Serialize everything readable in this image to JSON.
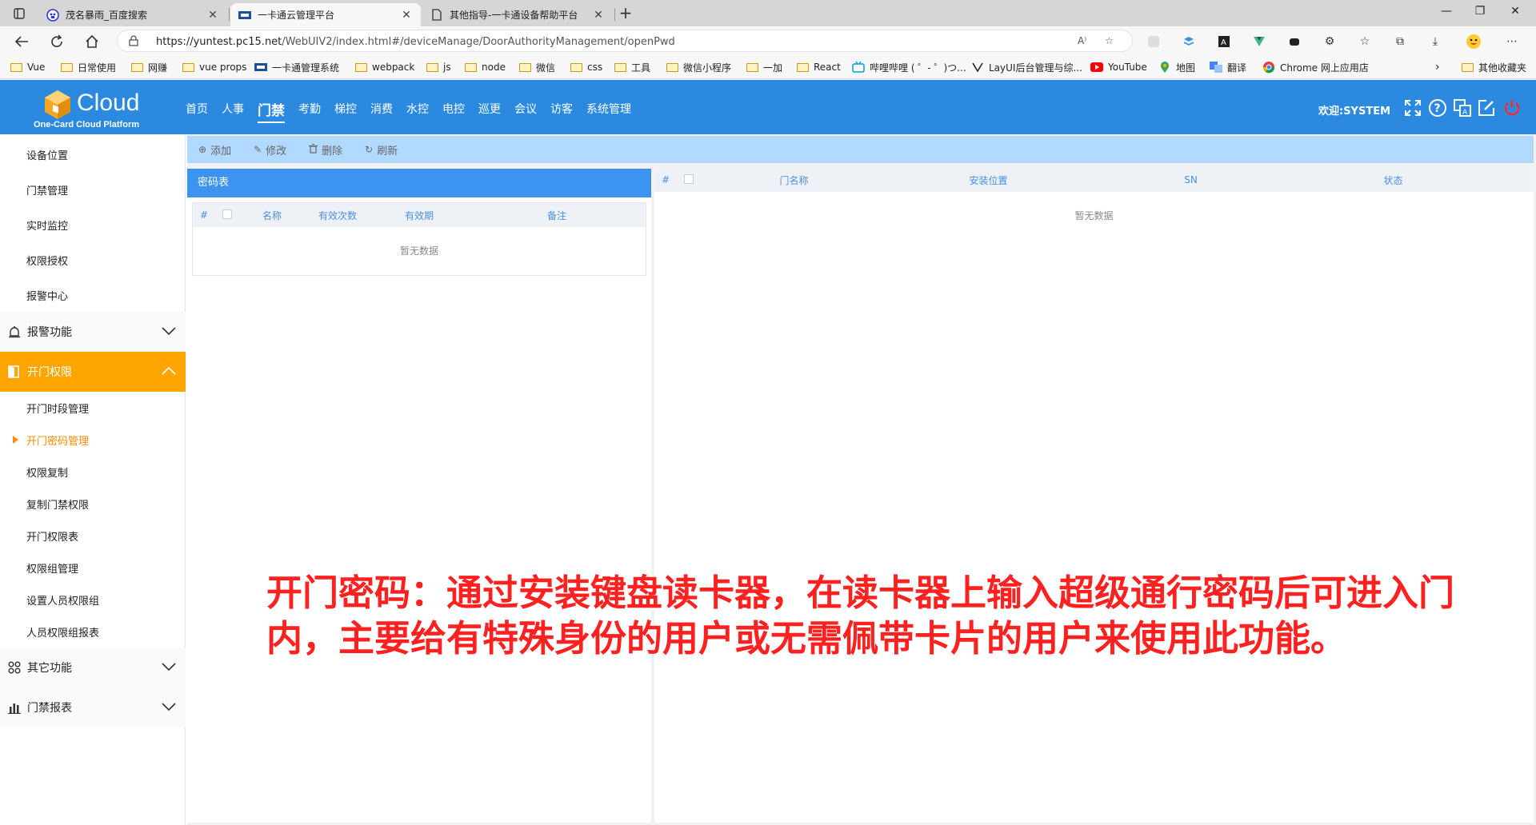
{
  "browser": {
    "tabs": [
      {
        "label": "茂名暴雨_百度搜索",
        "icon": "baidu-icon"
      },
      {
        "label": "一卡通云管理平台",
        "icon": "cloud-tab-icon"
      },
      {
        "label": "其他指导-一卡通设备帮助平台",
        "icon": "page-icon"
      }
    ],
    "url_host": "https://yuntest.pc15.net",
    "url_path": "/WebUIV2/index.html#/deviceManage/DoorAuthorityManagement/openPwd",
    "bookmarks": [
      "Vue",
      "日常使用",
      "网赚",
      "vue props",
      "一卡通管理系统",
      "webpack",
      "js",
      "node",
      "微信",
      "css",
      "工具",
      "微信小程序",
      "一加",
      "React",
      "哔哩哔哩 ( ゜- ゜)つ...",
      "LayUI后台管理与综...",
      "YouTube",
      "地图",
      "翻译",
      "Chrome 网上应用店"
    ],
    "other_bookmarks": "其他收藏夹"
  },
  "header": {
    "logo_title": "Cloud",
    "logo_subtitle": "One-Card Cloud Platform",
    "nav": [
      "首页",
      "人事",
      "门禁",
      "考勤",
      "梯控",
      "消费",
      "水控",
      "电控",
      "巡更",
      "会议",
      "访客",
      "系统管理"
    ],
    "active_nav": "门禁",
    "welcome": "欢迎:SYSTEM",
    "brand_color": "#2b8ae0"
  },
  "sidebar": {
    "top_items": [
      "设备位置",
      "门禁管理",
      "实时监控",
      "权限授权",
      "报警中心"
    ],
    "group_alarm": "报警功能",
    "group_open": "开门权限",
    "open_items": [
      "开门时段管理",
      "开门密码管理",
      "权限复制",
      "复制门禁权限",
      "开门权限表",
      "权限组管理",
      "设置人员权限组",
      "人员权限组报表"
    ],
    "selected_item": "开门密码管理",
    "group_other": "其它功能",
    "group_report": "门禁报表",
    "accent_color": "#ffa500"
  },
  "actions": {
    "add": "添加",
    "edit": "修改",
    "delete": "删除",
    "refresh": "刷新"
  },
  "left_panel": {
    "title": "密码表",
    "columns": [
      "#",
      "名称",
      "有效次数",
      "有效期",
      "备注"
    ],
    "empty_text": "暂无数据"
  },
  "right_panel": {
    "columns": [
      "#",
      "门名称",
      "安装位置",
      "SN",
      "状态"
    ],
    "empty_text": "暂无数据"
  },
  "caption": {
    "line1": "开门密码：通过安装键盘读卡器，在读卡器上输入超级通行密码后可进入门",
    "line2": "内，主要给有特殊身份的用户或无需佩带卡片的用户来使用此功能。"
  }
}
